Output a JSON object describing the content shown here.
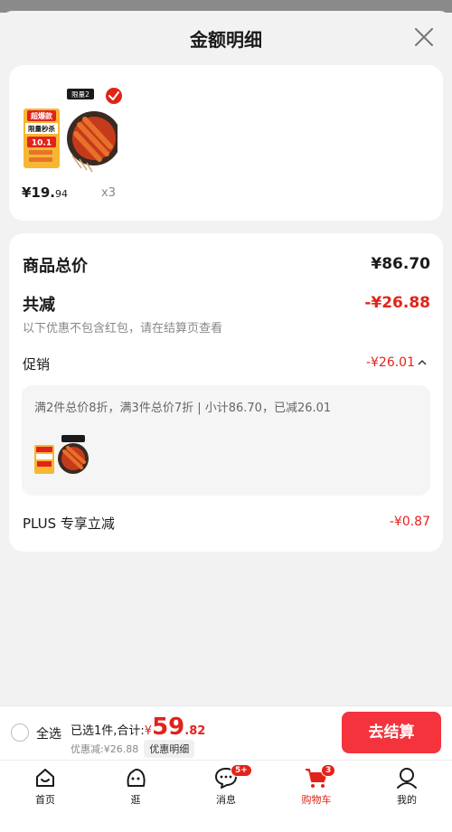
{
  "sheet": {
    "title": "金额明细"
  },
  "product": {
    "badge_top": "超爆款",
    "badge_mid": "限量秒杀",
    "badge_date": "10.1",
    "badge_tag": "限量2",
    "price_int": "¥19.",
    "price_dec": "94",
    "qty": "x3"
  },
  "summary": {
    "goods_total_label": "商品总价",
    "goods_total_value": "¥86.70",
    "reduce_label": "共减",
    "reduce_value": "-¥26.88",
    "note": "以下优惠不包含红包，请在结算页查看",
    "promo_label": "促销",
    "promo_value": "-¥26.01",
    "promo_detail": "满2件总价8折，满3件总价7折 | 小计86.70，已减26.01",
    "plus_label": "PLUS 专享立减",
    "plus_value": "-¥0.87"
  },
  "checkout": {
    "select_all": "全选",
    "selected_text": "已选1件,合计:",
    "total_currency": "¥",
    "total_int": "59",
    "total_dec": ".82",
    "discount_text": "优惠减:¥26.88",
    "detail_chip": "优惠明细",
    "button": "去结算"
  },
  "tabs": [
    {
      "label": "首页",
      "icon": "home-icon"
    },
    {
      "label": "逛",
      "icon": "browse-icon"
    },
    {
      "label": "消息",
      "icon": "message-icon",
      "badge": "5+"
    },
    {
      "label": "购物车",
      "icon": "cart-icon",
      "badge": "3",
      "active": true
    },
    {
      "label": "我的",
      "icon": "profile-icon"
    }
  ],
  "colors": {
    "accent": "#e2231a",
    "button": "#f4333c"
  }
}
